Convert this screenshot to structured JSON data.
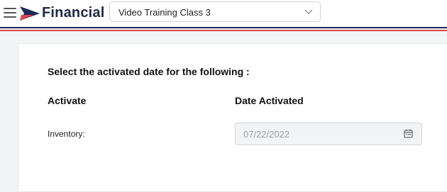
{
  "header": {
    "brand": "Financial",
    "company_select": {
      "value": "Video Training Class 3"
    },
    "icons": {
      "menu": "hamburger-menu-icon",
      "logo": "flag-logo-icon",
      "chevron": "chevron-down-icon"
    },
    "colors": {
      "navy": "#1c2a5a",
      "red": "#d9434a"
    }
  },
  "form": {
    "heading": "Select the activated date for the following :",
    "columns": {
      "activate": "Activate",
      "date_activated": "Date Activated"
    },
    "rows": [
      {
        "label": "Inventory:",
        "date": "07/22/2022",
        "disabled": true
      }
    ],
    "icons": {
      "calendar": "calendar-icon"
    }
  }
}
